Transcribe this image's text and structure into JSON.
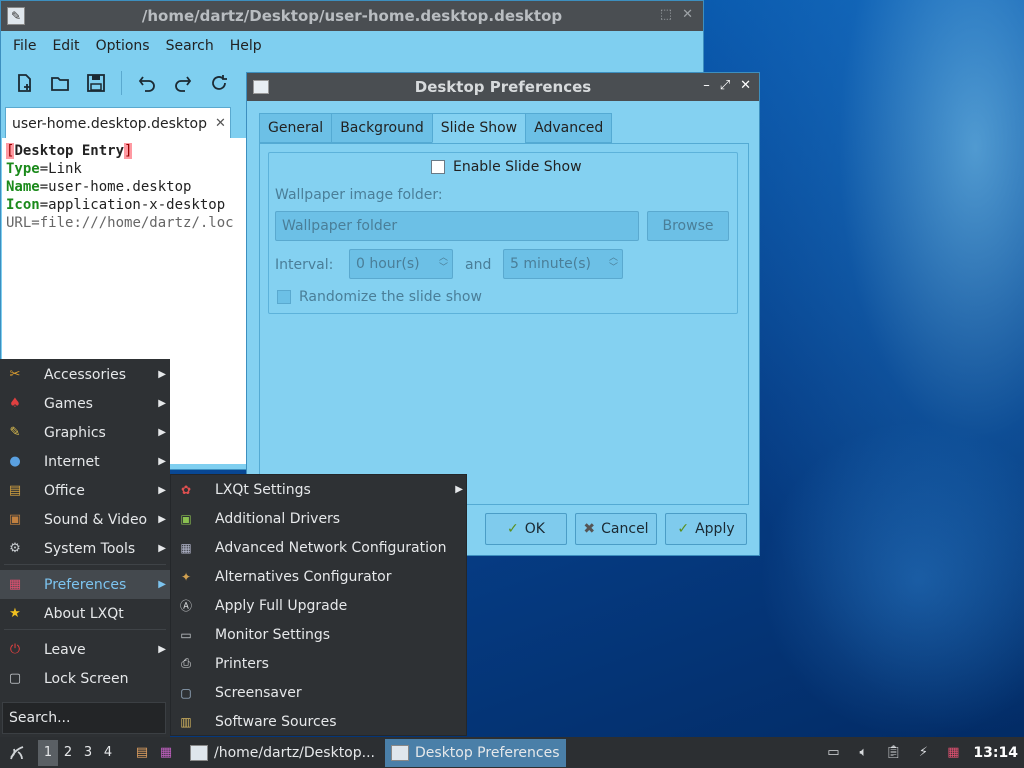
{
  "editor": {
    "title": "/home/dartz/Desktop/user-home.desktop.desktop",
    "menu": [
      "File",
      "Edit",
      "Options",
      "Search",
      "Help"
    ],
    "tab_label": "user-home.desktop.desktop",
    "lines": {
      "l1_open": "[",
      "l1_text": "Desktop Entry",
      "l1_close": "]",
      "l2_key": "Type",
      "l2_val": "=Link",
      "l3_key": "Name",
      "l3_val": "=user-home.desktop",
      "l4_key": "Icon",
      "l4_val": "=application-x-desktop",
      "l5_key": "URL",
      "l5_val": "=file:///home/dartz/.loc"
    }
  },
  "dialog": {
    "title": "Desktop Preferences",
    "tabs": [
      "General",
      "Background",
      "Slide Show",
      "Advanced"
    ],
    "active_tab": "Slide Show",
    "enable_label": "Enable Slide Show",
    "folder_label": "Wallpaper image folder:",
    "folder_placeholder": "Wallpaper folder",
    "browse_label": "Browse",
    "interval_label": "Interval:",
    "hours_value": "0 hour(s)",
    "and_label": "and",
    "minutes_value": "5 minute(s)",
    "randomize_label": "Randomize the slide show",
    "ok_label": "OK",
    "cancel_label": "Cancel",
    "apply_label": "Apply"
  },
  "start_menu": {
    "items": [
      "Accessories",
      "Games",
      "Graphics",
      "Internet",
      "Office",
      "Sound & Video",
      "System Tools",
      "Preferences",
      "About LXQt",
      "Leave",
      "Lock Screen"
    ],
    "active_item": "Preferences",
    "search_placeholder": "Search..."
  },
  "preferences_submenu": {
    "items": [
      "LXQt Settings",
      "Additional Drivers",
      "Advanced Network Configuration",
      "Alternatives Configurator",
      "Apply Full Upgrade",
      "Monitor Settings",
      "Printers",
      "Screensaver",
      "Software Sources"
    ]
  },
  "taskbar": {
    "desktops": [
      "1",
      "2",
      "3",
      "4"
    ],
    "active_desktop": "1",
    "tasks": [
      "/home/dartz/Desktop...",
      "Desktop Preferences"
    ],
    "clock": "13:14"
  },
  "colors": {
    "accent": "#4a7fa8",
    "menu_bg": "#2e3134",
    "dialog_bg": "#84d1f1",
    "titlebar": "#4a4e52"
  }
}
